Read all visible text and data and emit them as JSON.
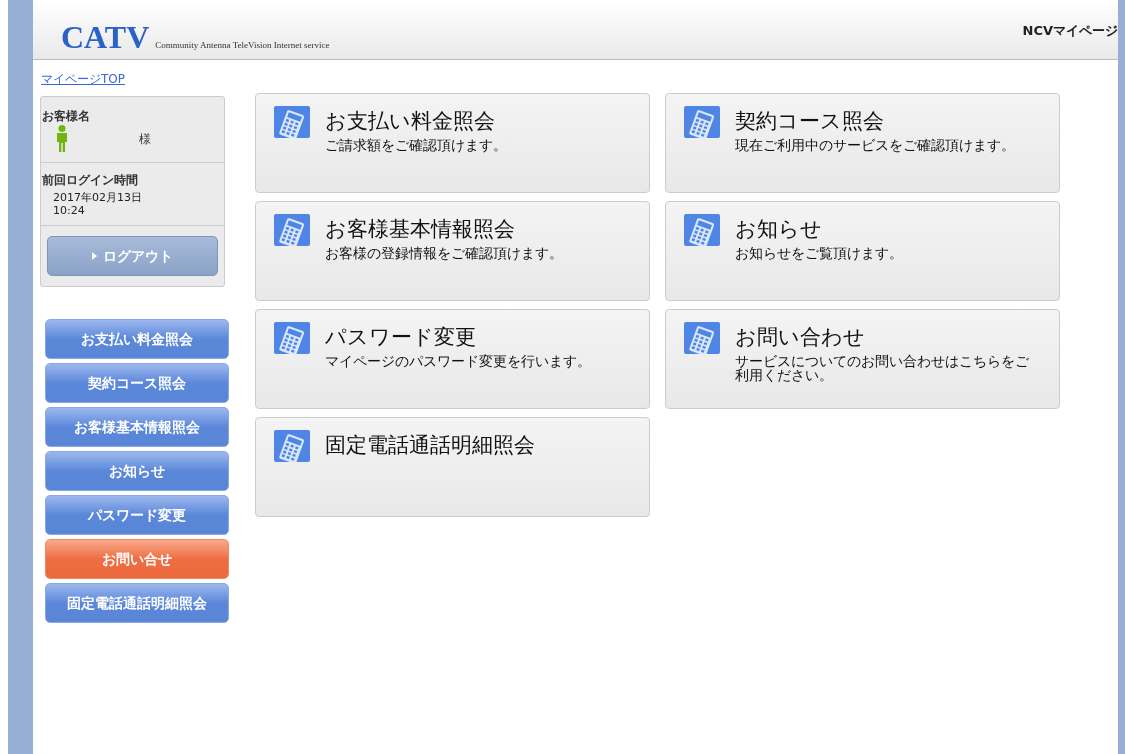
{
  "header": {
    "logo": "CATV",
    "tagline": "Community Antenna TeleVision Internet service",
    "site_title": "NCVマイページ"
  },
  "breadcrumb": "マイページTOP",
  "user_panel": {
    "name_label": "お客様名",
    "name_suffix": "様",
    "last_login_label": "前回ログイン時間",
    "last_login_date": "2017年02月13日",
    "last_login_time": "10:24",
    "logout_button": "ログアウト"
  },
  "side_menu": [
    {
      "label": "お支払い料金照会",
      "selected": false
    },
    {
      "label": "契約コース照会",
      "selected": false
    },
    {
      "label": "お客様基本情報照会",
      "selected": false
    },
    {
      "label": "お知らせ",
      "selected": false
    },
    {
      "label": "パスワード変更",
      "selected": false
    },
    {
      "label": "お問い合せ",
      "selected": true
    },
    {
      "label": "固定電話通話明細照会",
      "selected": false
    }
  ],
  "cards": [
    {
      "title": "お支払い料金照会",
      "description": "ご請求額をご確認頂けます。"
    },
    {
      "title": "契約コース照会",
      "description": "現在ご利用中のサービスをご確認頂けます。"
    },
    {
      "title": "お客様基本情報照会",
      "description": "お客様の登録情報をご確認頂けます。"
    },
    {
      "title": "お知らせ",
      "description": "お知らせをご覧頂けます。"
    },
    {
      "title": "パスワード変更",
      "description": "マイページのパスワード変更を行います。"
    },
    {
      "title": "お問い合わせ",
      "description": "サービスについてのお問い合わせはこちらをご利用ください。"
    },
    {
      "title": "固定電話通話明細照会"
    }
  ]
}
